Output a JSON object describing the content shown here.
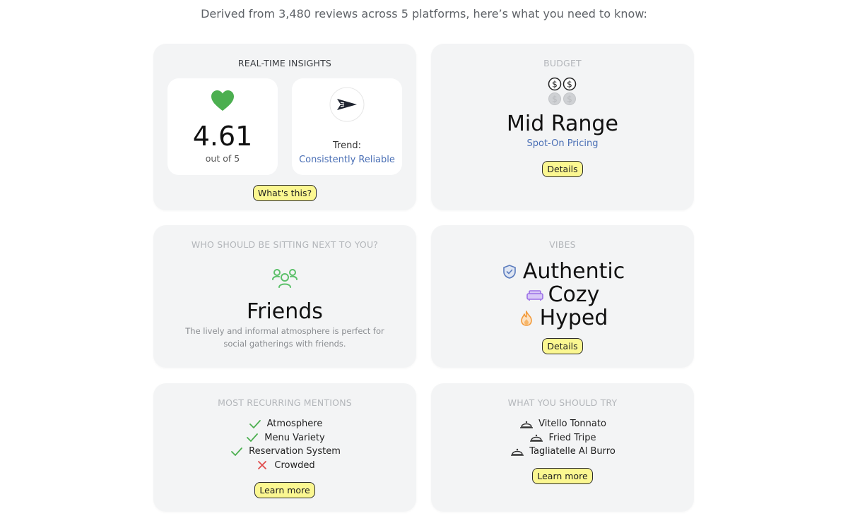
{
  "intro_text": "Derived from 3,480 reviews across 5 platforms, here’s what you need to know:",
  "colors": {
    "card_bg": "#f3f4f5",
    "pill_bg": "#fbf791",
    "heart": "#4caf50",
    "link_blue": "#4a6fb5",
    "friends_green": "#5cc06a"
  },
  "insights": {
    "title": "REAL-TIME INSIGHTS",
    "score": "4.61",
    "score_sub": "out of 5",
    "trend_label": "Trend:",
    "trend_value": "Consistently Reliable",
    "button": "What's this?"
  },
  "budget": {
    "title": "BUDGET",
    "value": "Mid Range",
    "sub": "Spot-On Pricing",
    "button": "Details",
    "icon": "dollar-coins-icon"
  },
  "seating": {
    "title": "WHO SHOULD BE SITTING NEXT TO YOU?",
    "value": "Friends",
    "description": "The lively and informal atmosphere is perfect for social gatherings with friends.",
    "icon": "friends-group-icon"
  },
  "vibes": {
    "title": "VIBES",
    "items": [
      {
        "label": "Authentic",
        "icon": "shield-check-icon"
      },
      {
        "label": "Cozy",
        "icon": "sofa-icon"
      },
      {
        "label": "Hyped",
        "icon": "flame-icon"
      }
    ],
    "button": "Details"
  },
  "mentions": {
    "title": "MOST RECURRING MENTIONS",
    "items": [
      {
        "label": "Atmosphere",
        "positive": true
      },
      {
        "label": "Menu Variety",
        "positive": true
      },
      {
        "label": "Reservation System",
        "positive": true
      },
      {
        "label": "Crowded",
        "positive": false
      }
    ],
    "button": "Learn more"
  },
  "try": {
    "title": "WHAT YOU SHOULD TRY",
    "items": [
      {
        "label": "Vitello Tonnato"
      },
      {
        "label": "Fried Tripe"
      },
      {
        "label": "Tagliatelle Al Burro"
      }
    ],
    "button": "Learn more"
  }
}
